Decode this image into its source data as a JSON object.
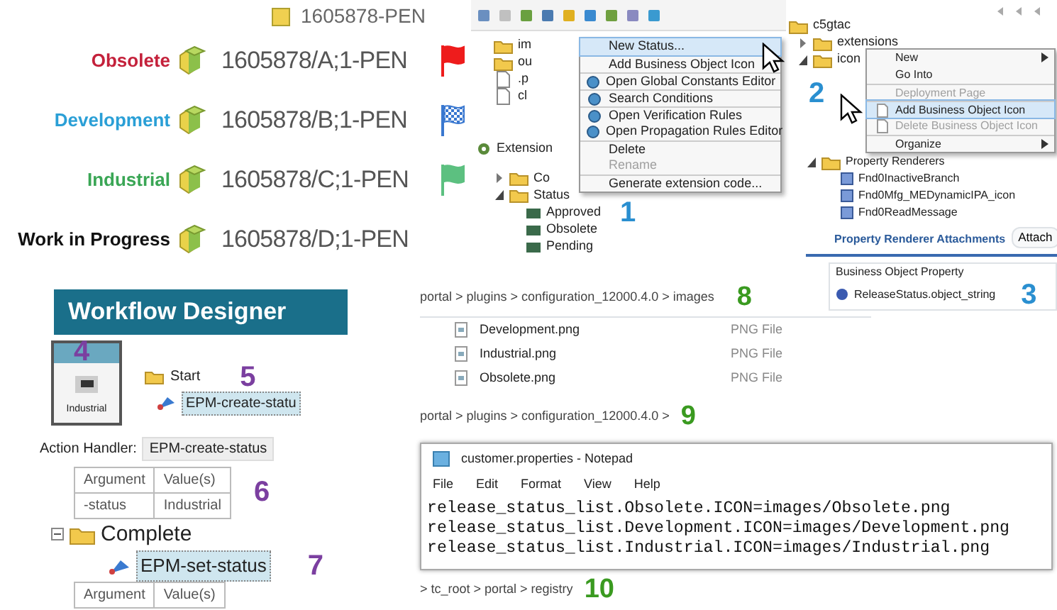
{
  "status_list": {
    "parent_item": "1605878-PEN",
    "items": [
      {
        "status": "Obsolete",
        "color": "#c4213b",
        "item": "1605878/A;1-PEN",
        "flag": {
          "kind": "solid",
          "color": "#ee1c1c"
        }
      },
      {
        "status": "Development",
        "color": "#2a9fd6",
        "item": "1605878/B;1-PEN",
        "flag": {
          "kind": "checkered",
          "color": "#3a78d0"
        }
      },
      {
        "status": "Industrial",
        "color": "#3aa655",
        "item": "1605878/C;1-PEN",
        "flag": {
          "kind": "solid",
          "color": "#5cc080"
        }
      },
      {
        "status": "Work in Progress",
        "color": "#111111",
        "item": "1605878/D;1-PEN"
      }
    ]
  },
  "eclipse_panel": {
    "project_items": [
      {
        "label": "im",
        "kind": "folder"
      },
      {
        "label": "ou",
        "kind": "folder"
      },
      {
        "label": ".p",
        "kind": "file"
      },
      {
        "label": "cl",
        "kind": "file"
      }
    ],
    "context_menu": [
      {
        "label": "New Status...",
        "selected": true,
        "disabled": false,
        "has_icon": false,
        "separator_before": false
      },
      {
        "label": "Add Business Object Icon",
        "selected": false,
        "disabled": false,
        "has_icon": false,
        "separator_before": true
      },
      {
        "label": "Open Global Constants Editor",
        "selected": false,
        "disabled": false,
        "has_icon": true,
        "separator_before": true
      },
      {
        "label": "Search Conditions",
        "selected": false,
        "disabled": false,
        "has_icon": true,
        "separator_before": true
      },
      {
        "label": "Open Verification Rules",
        "selected": false,
        "disabled": false,
        "has_icon": true,
        "separator_before": true
      },
      {
        "label": "Open Propagation Rules Editor",
        "selected": false,
        "disabled": false,
        "has_icon": true,
        "separator_before": false
      },
      {
        "label": "Delete",
        "selected": false,
        "disabled": false,
        "has_icon": false,
        "separator_before": true
      },
      {
        "label": "Rename",
        "selected": false,
        "disabled": true,
        "has_icon": false,
        "separator_before": false
      },
      {
        "label": "Generate extension code...",
        "selected": false,
        "disabled": false,
        "has_icon": false,
        "separator_before": true
      }
    ],
    "view_tab": "Extension",
    "tree": [
      {
        "label": "Co",
        "kind": "folder",
        "expanded": false
      },
      {
        "label": "Status",
        "kind": "folder",
        "expanded": true,
        "children": [
          {
            "label": "Approved"
          },
          {
            "label": "Obsolete"
          },
          {
            "label": "Pending"
          }
        ]
      }
    ],
    "step": "1"
  },
  "icons_panel": {
    "tree": [
      {
        "label": "c5gtac",
        "kind": "project"
      },
      {
        "label": "extensions",
        "kind": "folder",
        "expanded": false
      },
      {
        "label": "icon",
        "kind": "folder",
        "expanded": true
      }
    ],
    "context_menu": [
      {
        "label": "New",
        "selected": false,
        "disabled": false,
        "submenu": true,
        "separator_before": false
      },
      {
        "label": "Go Into",
        "selected": false,
        "disabled": false,
        "submenu": false,
        "separator_before": false
      },
      {
        "label": "Deployment Page",
        "selected": false,
        "disabled": true,
        "submenu": false,
        "separator_before": true
      },
      {
        "label": "Add Business Object Icon",
        "selected": true,
        "disabled": false,
        "submenu": false,
        "separator_before": true
      },
      {
        "label": "Delete Business Object Icon",
        "selected": false,
        "disabled": true,
        "submenu": false,
        "separator_before": false
      },
      {
        "label": "Organize",
        "selected": false,
        "disabled": false,
        "submenu": true,
        "separator_before": true
      }
    ],
    "step": "2"
  },
  "renderers_panel": {
    "folder": "Property Renderers",
    "renderers": [
      "Fnd0InactiveBranch",
      "Fnd0Mfg_MEDynamicIPA_icon",
      "Fnd0ReadMessage"
    ],
    "attach_button": "Attach",
    "section": "Property Renderer Attachments",
    "column": "Business Object Property",
    "property": "ReleaseStatus.object_string",
    "step": "3"
  },
  "workflow": {
    "title": "Workflow Designer",
    "tile_label": "Industrial",
    "tile_step": "4",
    "start_node": "Start",
    "start_handler": "EPM-create-statu",
    "start_step": "5",
    "action_handler_label": "Action Handler:",
    "action_handler": "EPM-create-status",
    "table": {
      "columns": [
        "Argument",
        "Value(s)"
      ],
      "rows": [
        [
          "-status",
          "Industrial"
        ]
      ]
    },
    "table_step": "6",
    "complete_node": "Complete",
    "complete_handler": "EPM-set-status",
    "complete_step": "7",
    "table2": {
      "columns": [
        "Argument",
        "Value(s)"
      ]
    }
  },
  "images_folder": {
    "path": "portal > plugins > configuration_12000.4.0 > images",
    "step": "8",
    "files": [
      {
        "name": "Development.png",
        "type": "PNG File"
      },
      {
        "name": "Industrial.png",
        "type": "PNG File"
      },
      {
        "name": "Obsolete.png",
        "type": "PNG File"
      }
    ]
  },
  "config_folder": {
    "path": "portal > plugins > configuration_12000.4.0 >",
    "step": "9"
  },
  "notepad": {
    "title": "customer.properties - Notepad",
    "menu": [
      "File",
      "Edit",
      "Format",
      "View",
      "Help"
    ],
    "lines": [
      "release_status_list.Obsolete.ICON=images/Obsolete.png",
      "release_status_list.Development.ICON=images/Development.png",
      "release_status_list.Industrial.ICON=images/Industrial.png"
    ]
  },
  "registry_folder": {
    "path": "> tc_root > portal > registry",
    "step": "10"
  }
}
